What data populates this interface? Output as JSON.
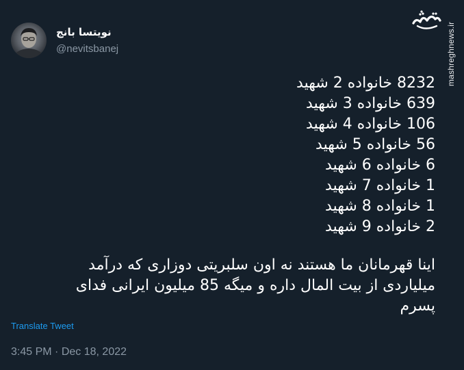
{
  "author": {
    "name": "نویتسا بانج",
    "handle": "@nevitsbanej"
  },
  "watermark": {
    "logo_text": "مشرق",
    "url": "mashreghnews.ir"
  },
  "tweet": {
    "stats": [
      "8232 خانواده 2 شهید",
      "639 خانواده 3 شهید",
      "106 خانواده 4 شهید",
      "56 خانواده 5 شهید",
      "6 خانواده 6 شهید",
      "1 خانواده 7 شهید",
      "1 خانواده 8 شهید",
      "2 خانواده 9 شهید"
    ],
    "paragraph_lines": [
      "اینا قهرمانان ما هستند نه اون سلبریتی دوزاری که درآمد",
      "میلیاردی از بیت المال داره و میگه 85 میلیون ایرانی فدای",
      "پسرم"
    ],
    "translate_label": "Translate Tweet",
    "time": "3:45 PM",
    "separator": "·",
    "date": "Dec 18, 2022"
  },
  "colors": {
    "background": "#15202b",
    "text": "#ffffff",
    "secondary": "#8b98a5",
    "link": "#1d9bf0"
  }
}
